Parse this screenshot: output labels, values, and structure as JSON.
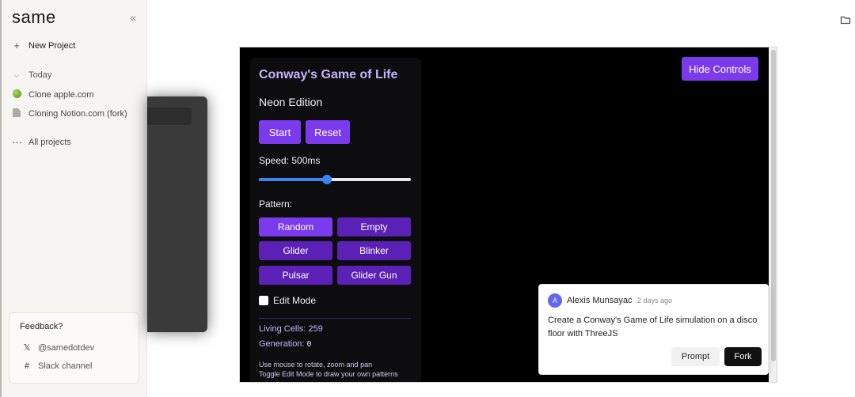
{
  "sidebar": {
    "logo": "same",
    "collapse_icon": "chevrons-left-icon",
    "new_project": "New Project",
    "section_today": "Today",
    "projects": [
      {
        "label": "Clone apple.com",
        "icon": "apple-icon"
      },
      {
        "label": "Cloning Notion.com (fork)",
        "icon": "document-icon"
      }
    ],
    "all_projects": "All projects",
    "feedback": {
      "title": "Feedback?",
      "twitter": "@samedotdev",
      "slack": "Slack channel"
    }
  },
  "preview": {
    "controls": {
      "title": "Conway's Game of Life",
      "subtitle": "Neon Edition",
      "start": "Start",
      "reset": "Reset",
      "speed_label": "Speed: 500ms",
      "speed_fraction": 0.45,
      "pattern_label": "Pattern:",
      "patterns": [
        "Random",
        "Empty",
        "Glider",
        "Blinker",
        "Pulsar",
        "Glider Gun"
      ],
      "active_pattern": "Random",
      "edit_mode": "Edit Mode",
      "edit_mode_checked": false,
      "living_cells": "Living Cells: 259",
      "generation_label": "Generation: ",
      "generation_value": "0",
      "hint1": "Use mouse to rotate, zoom and pan",
      "hint2": "Toggle Edit Mode to draw your own patterns"
    },
    "hide_controls": "Hide Controls"
  },
  "prompt_card": {
    "avatar_initial": "A",
    "author": "Alexis Munsayac",
    "when": "2 days ago",
    "text": "Create a Conway's Game of Life simulation on a disco floor with ThreeJS",
    "prompt_button": "Prompt",
    "fork_button": "Fork"
  },
  "colors": {
    "accent_purple": "#7c3aed",
    "dark_purple": "#5b21b6",
    "title_lavender": "#c4b5fd",
    "slider_blue": "#3b82f6"
  }
}
